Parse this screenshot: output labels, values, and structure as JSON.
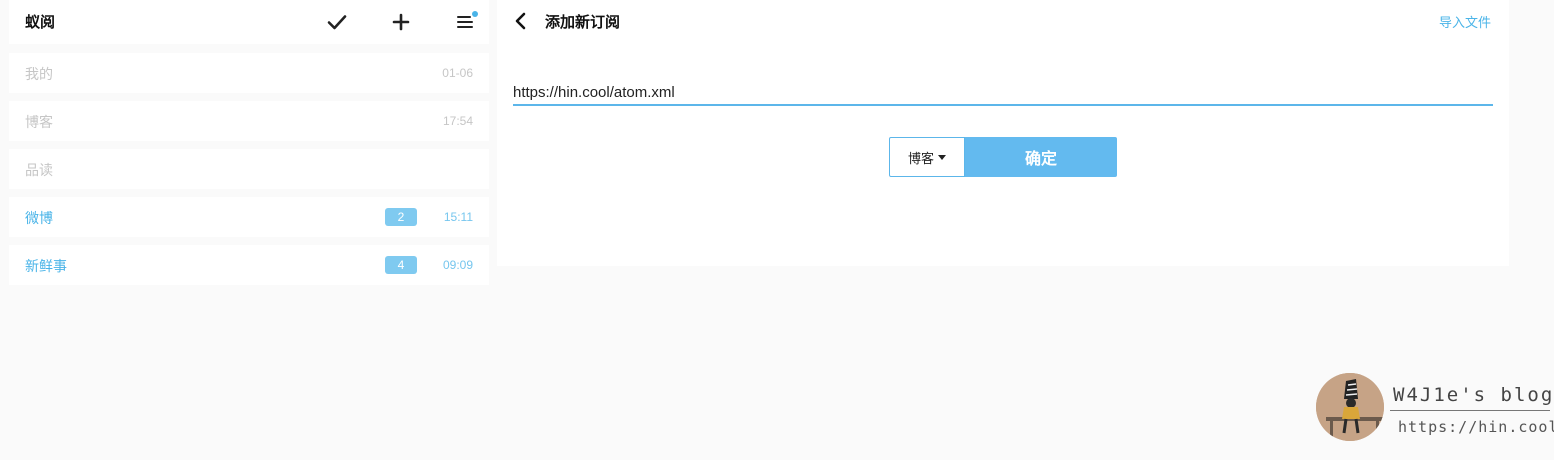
{
  "app": {
    "title": "蚁阅"
  },
  "header_icons": {
    "mark_read": "check-icon",
    "add": "plus-icon",
    "menu": "menu-icon"
  },
  "sidebar": {
    "groups": [
      {
        "name": "我的",
        "time": "01-06",
        "badge": null,
        "active": false
      },
      {
        "name": "博客",
        "time": "17:54",
        "badge": null,
        "active": false
      },
      {
        "name": "品读",
        "time": "",
        "badge": null,
        "active": false
      },
      {
        "name": "微博",
        "time": "15:11",
        "badge": "2",
        "active": true
      },
      {
        "name": "新鲜事",
        "time": "09:09",
        "badge": "4",
        "active": true
      }
    ]
  },
  "main": {
    "title": "添加新订阅",
    "import_label": "导入文件",
    "url_value": "https://hin.cool/atom.xml",
    "category_label": "博客",
    "confirm_label": "确定"
  },
  "watermark": {
    "title": "W4J1e's blog",
    "url": "https://hin.cool"
  },
  "colors": {
    "accent": "#4ab4e8",
    "button": "#63baef",
    "muted": "#c6c6c6",
    "background": "#fafafa"
  }
}
